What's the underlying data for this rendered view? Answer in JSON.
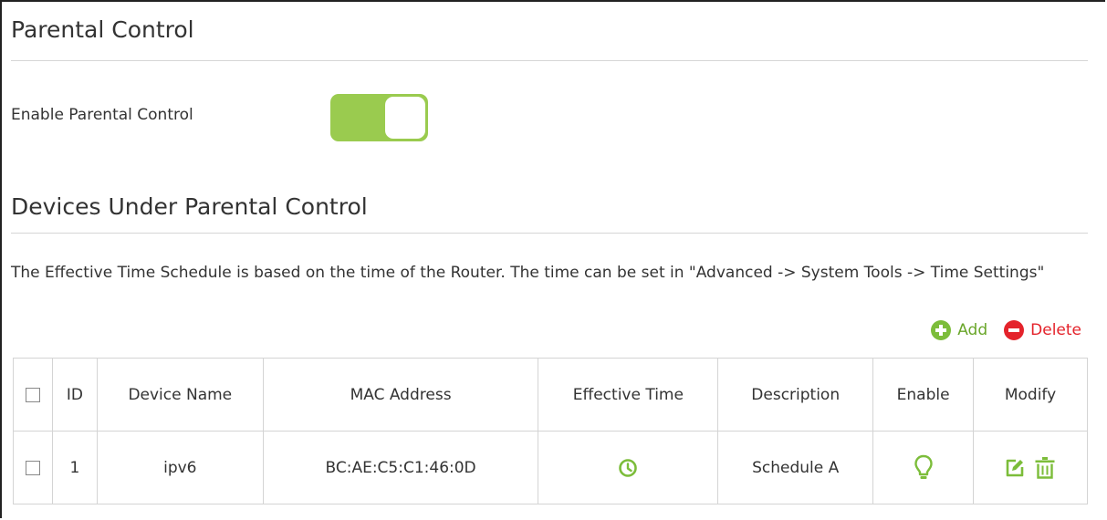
{
  "parental_control": {
    "title": "Parental Control",
    "enable_label": "Enable Parental Control",
    "enabled": true
  },
  "devices": {
    "title": "Devices Under Parental Control",
    "note": "The Effective Time Schedule is based on the time of the Router. The time can be set in \"Advanced -> System Tools -> Time Settings\"",
    "add_label": "Add",
    "delete_label": "Delete"
  },
  "table": {
    "headers": [
      "ID",
      "Device Name",
      "MAC Address",
      "Effective Time",
      "Description",
      "Enable",
      "Modify"
    ],
    "rows": [
      {
        "id": "1",
        "device_name": "ipv6",
        "mac": "BC:AE:C5:C1:46:0D",
        "effective_time_icon": "clock-icon",
        "description": "Schedule A",
        "enable_icon": "bulb-icon",
        "modify_icons": [
          "edit-icon",
          "trash-icon"
        ]
      }
    ]
  },
  "colors": {
    "accent_green": "#9acb4f",
    "icon_green": "#7cbd3a",
    "delete_red": "#e4232b",
    "border": "#d4d4d4"
  }
}
